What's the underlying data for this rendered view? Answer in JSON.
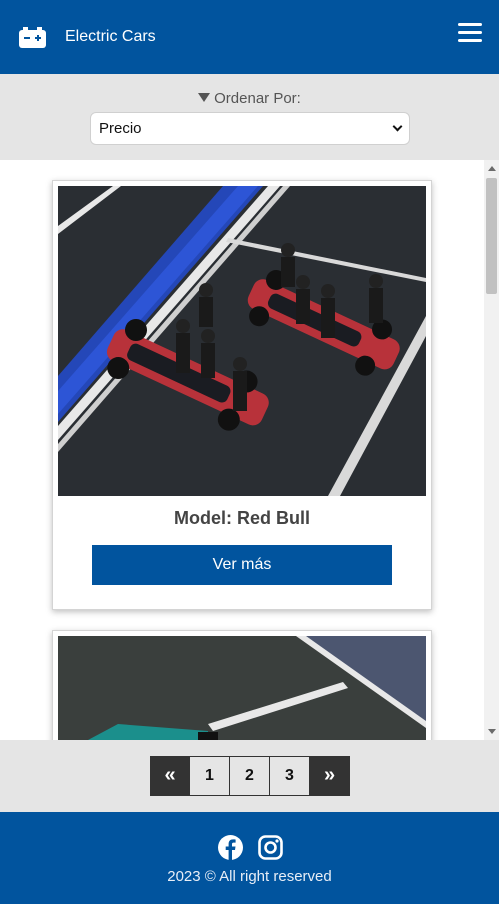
{
  "header": {
    "brand_icon": "car-battery-icon",
    "brand_name": "Electric Cars",
    "menu_icon": "hamburger-menu-icon"
  },
  "sort": {
    "label": "Ordenar Por:",
    "selected": "Precio",
    "icon": "filter-icon"
  },
  "cards": [
    {
      "title": "Model: Red Bull",
      "button_label": "Ver más",
      "image": "race-cars-pit-lane-photo"
    },
    {
      "title": "",
      "button_label": "",
      "image": "teal-race-car-photo"
    }
  ],
  "pagination": {
    "prev_label": "«",
    "pages": [
      "1",
      "2",
      "3"
    ],
    "next_label": "»"
  },
  "footer": {
    "icons": [
      "facebook-icon",
      "instagram-icon"
    ],
    "copyright": "2023 © All right reserved"
  },
  "colors": {
    "primary": "#01549e",
    "bar_gray": "#e5e5e5",
    "pager_dark": "#333333"
  }
}
